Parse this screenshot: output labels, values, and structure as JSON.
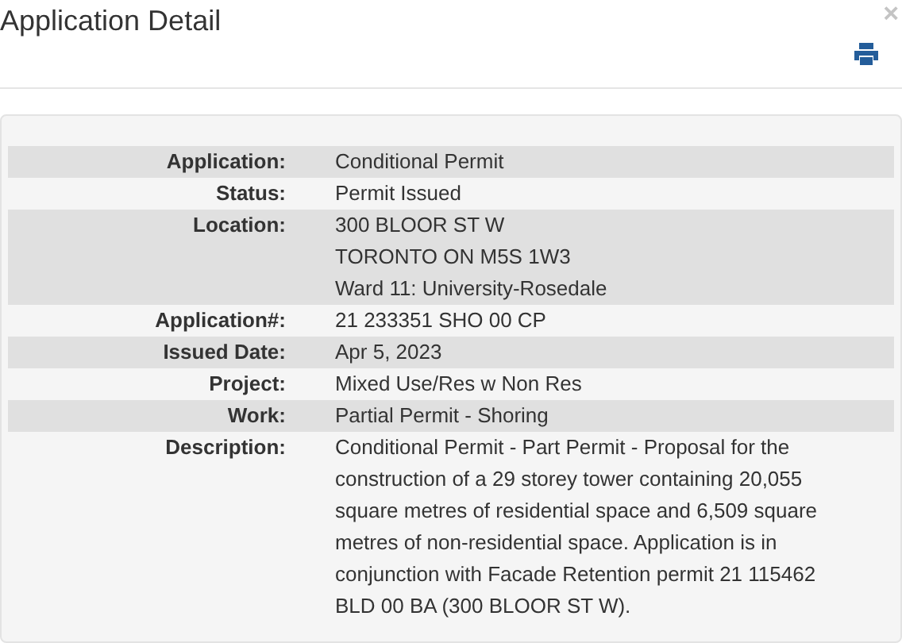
{
  "dialog": {
    "title": "Application Detail",
    "close": "×"
  },
  "details": [
    {
      "label": "Application:",
      "lines": [
        "Conditional Permit"
      ]
    },
    {
      "label": "Status:",
      "lines": [
        "Permit Issued"
      ]
    },
    {
      "label": "Location:",
      "lines": [
        "300 BLOOR ST W",
        "TORONTO ON M5S 1W3",
        "Ward 11: University-Rosedale"
      ]
    },
    {
      "label": "Application#:",
      "lines": [
        "21 233351 SHO 00 CP"
      ]
    },
    {
      "label": "Issued Date:",
      "lines": [
        "Apr 5, 2023"
      ]
    },
    {
      "label": "Project:",
      "lines": [
        "Mixed Use/Res w Non Res"
      ]
    },
    {
      "label": "Work:",
      "lines": [
        "Partial Permit - Shoring"
      ]
    },
    {
      "label": "Description:",
      "lines": [
        "Conditional Permit - Part Permit - Proposal for the construction of a 29 storey tower containing 20,055 square metres of residential space and 6,509 square metres of non-residential space. Application is in conjunction with Facade Retention permit 21 115462 BLD 00 BA (300 BLOOR ST W)."
      ]
    }
  ]
}
